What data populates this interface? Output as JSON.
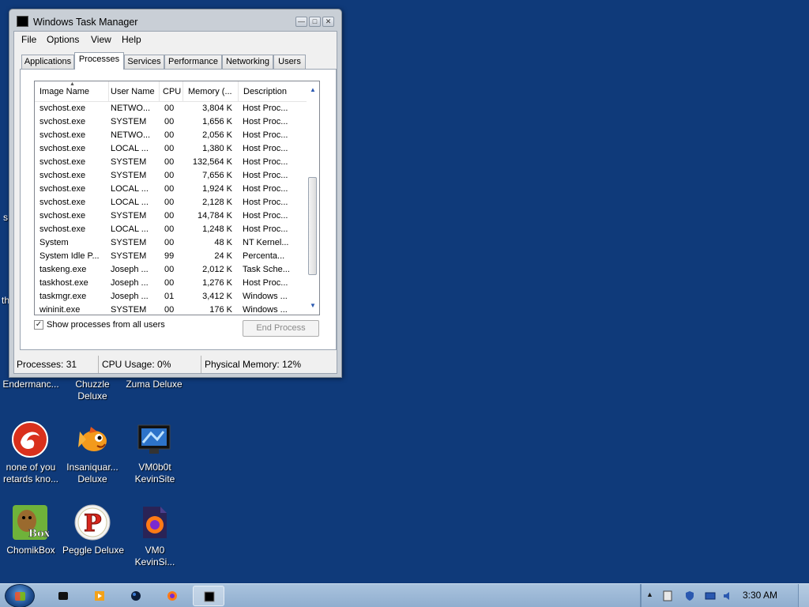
{
  "window": {
    "title": "Windows Task Manager",
    "menu": [
      "File",
      "Options",
      "View",
      "Help"
    ],
    "tabs": [
      "Applications",
      "Processes",
      "Services",
      "Performance",
      "Networking",
      "Users"
    ],
    "active_tab": "Processes",
    "columns": [
      "Image Name",
      "User Name",
      "CPU",
      "Memory (...",
      "Description"
    ],
    "processes": [
      {
        "image": "svchost.exe",
        "user": "NETWO...",
        "cpu": "00",
        "memory": "3,804 K",
        "desc": "Host Proc..."
      },
      {
        "image": "svchost.exe",
        "user": "SYSTEM",
        "cpu": "00",
        "memory": "1,656 K",
        "desc": "Host Proc..."
      },
      {
        "image": "svchost.exe",
        "user": "NETWO...",
        "cpu": "00",
        "memory": "2,056 K",
        "desc": "Host Proc..."
      },
      {
        "image": "svchost.exe",
        "user": "LOCAL ...",
        "cpu": "00",
        "memory": "1,380 K",
        "desc": "Host Proc..."
      },
      {
        "image": "svchost.exe",
        "user": "SYSTEM",
        "cpu": "00",
        "memory": "132,564 K",
        "desc": "Host Proc..."
      },
      {
        "image": "svchost.exe",
        "user": "SYSTEM",
        "cpu": "00",
        "memory": "7,656 K",
        "desc": "Host Proc..."
      },
      {
        "image": "svchost.exe",
        "user": "LOCAL ...",
        "cpu": "00",
        "memory": "1,924 K",
        "desc": "Host Proc..."
      },
      {
        "image": "svchost.exe",
        "user": "LOCAL ...",
        "cpu": "00",
        "memory": "2,128 K",
        "desc": "Host Proc..."
      },
      {
        "image": "svchost.exe",
        "user": "SYSTEM",
        "cpu": "00",
        "memory": "14,784 K",
        "desc": "Host Proc..."
      },
      {
        "image": "svchost.exe",
        "user": "LOCAL ...",
        "cpu": "00",
        "memory": "1,248 K",
        "desc": "Host Proc..."
      },
      {
        "image": "System",
        "user": "SYSTEM",
        "cpu": "00",
        "memory": "48 K",
        "desc": "NT Kernel..."
      },
      {
        "image": "System Idle P...",
        "user": "SYSTEM",
        "cpu": "99",
        "memory": "24 K",
        "desc": "Percenta..."
      },
      {
        "image": "taskeng.exe",
        "user": "Joseph ...",
        "cpu": "00",
        "memory": "2,012 K",
        "desc": "Task Sche..."
      },
      {
        "image": "taskhost.exe",
        "user": "Joseph ...",
        "cpu": "00",
        "memory": "1,276 K",
        "desc": "Host Proc..."
      },
      {
        "image": "taskmgr.exe",
        "user": "Joseph ...",
        "cpu": "01",
        "memory": "3,412 K",
        "desc": "Windows ..."
      },
      {
        "image": "wininit.exe",
        "user": "SYSTEM",
        "cpu": "00",
        "memory": "176 K",
        "desc": "Windows ..."
      }
    ],
    "show_all_label": "Show processes from all users",
    "show_all_checked": "✓",
    "end_process_label": "End Process",
    "status": {
      "processes": "Processes: 31",
      "cpu": "CPU Usage: 0%",
      "memory": "Physical Memory: 12%"
    }
  },
  "desktop": {
    "edge_text": [
      "s",
      "th"
    ],
    "icons": [
      {
        "label": "Endermanc...",
        "icon": "enderman-icon"
      },
      {
        "label": "Chuzzle\nDeluxe",
        "icon": "chuzzle-icon"
      },
      {
        "label": "Zuma Deluxe",
        "icon": "zuma-icon"
      },
      {
        "label": "none of you\nretards kno...",
        "icon": "red-swirl-icon"
      },
      {
        "label": "Insaniquar...\nDeluxe",
        "icon": "fish-icon"
      },
      {
        "label": "VM0b0t\nKevinSite",
        "icon": "monitor-icon"
      },
      {
        "label": "ChomikBox",
        "icon": "chomikbox-icon"
      },
      {
        "label": "Peggle Deluxe",
        "icon": "peggle-icon"
      },
      {
        "label": "VM0\nKevinSi...",
        "icon": "firefox-file-icon"
      }
    ]
  },
  "taskbar": {
    "buttons": [
      "cmd-icon",
      "media-player-icon",
      "blue-orb-icon",
      "firefox-icon",
      "task-manager-icon"
    ],
    "clock": "3:30 AM"
  },
  "colors": {
    "desktop": "#0f3a7a",
    "window_frame": "#c9cfd6",
    "taskbar": "#9fbad8",
    "scroll_arrow": "#2a58b0"
  }
}
